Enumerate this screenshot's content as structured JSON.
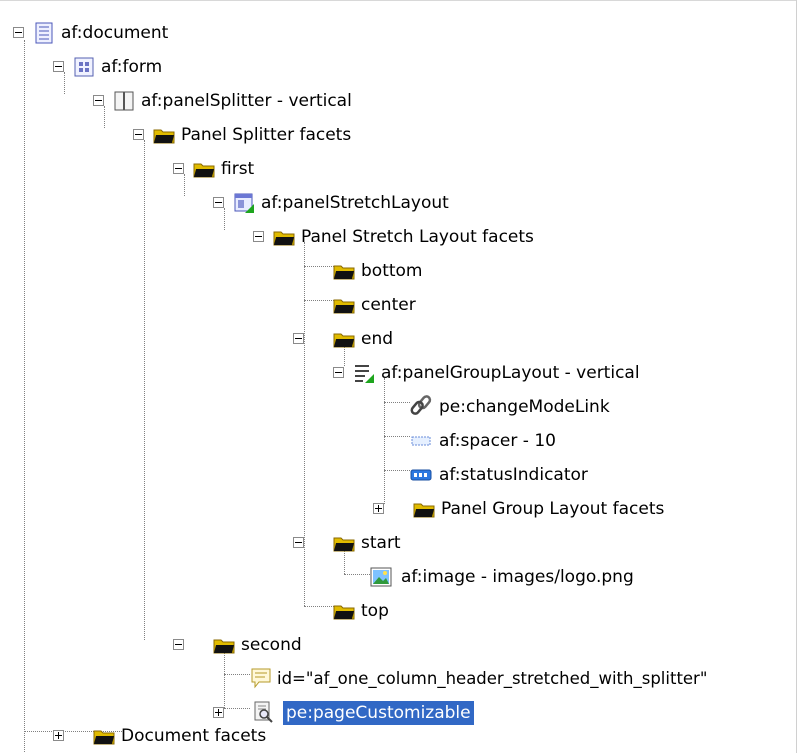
{
  "tree": {
    "nodes": [
      {
        "label": "af:document",
        "icon": "document-icon",
        "expanded": true
      },
      {
        "label": "af:form",
        "icon": "form-icon",
        "expanded": true
      },
      {
        "label": "af:panelSplitter - vertical",
        "icon": "splitter-icon",
        "expanded": true
      },
      {
        "label": "Panel Splitter facets",
        "icon": "folder-icon",
        "expanded": true
      },
      {
        "label": "first",
        "icon": "folder-icon",
        "expanded": true
      },
      {
        "label": "af:panelStretchLayout",
        "icon": "stretch-layout-icon",
        "expanded": true
      },
      {
        "label": "Panel Stretch Layout facets",
        "icon": "folder-icon",
        "expanded": true
      },
      {
        "label": "bottom",
        "icon": "folder-icon"
      },
      {
        "label": "center",
        "icon": "folder-icon"
      },
      {
        "label": "end",
        "icon": "folder-icon",
        "expanded": true
      },
      {
        "label": "af:panelGroupLayout - vertical",
        "icon": "group-layout-icon",
        "expanded": true
      },
      {
        "label": "pe:changeModeLink",
        "icon": "link-icon"
      },
      {
        "label": "af:spacer - 10",
        "icon": "spacer-icon"
      },
      {
        "label": "af:statusIndicator",
        "icon": "status-indicator-icon"
      },
      {
        "label": "Panel Group Layout facets",
        "icon": "folder-icon",
        "expanded": false
      },
      {
        "label": "start",
        "icon": "folder-icon",
        "expanded": true
      },
      {
        "label": "af:image - images/logo.png",
        "icon": "image-icon"
      },
      {
        "label": "top",
        "icon": "folder-icon"
      },
      {
        "label": "second",
        "icon": "folder-icon",
        "expanded": true
      },
      {
        "label": "id=\"af_one_column_header_stretched_with_splitter\"",
        "icon": "comment-icon"
      },
      {
        "label": "pe:pageCustomizable",
        "icon": "customizable-icon",
        "expanded": false,
        "selected": true
      },
      {
        "label": "Document facets",
        "icon": "folder-icon",
        "expanded": false
      }
    ]
  },
  "colors": {
    "selection": "#3168c5",
    "folder": "#d9b300",
    "connector": "#808080"
  }
}
